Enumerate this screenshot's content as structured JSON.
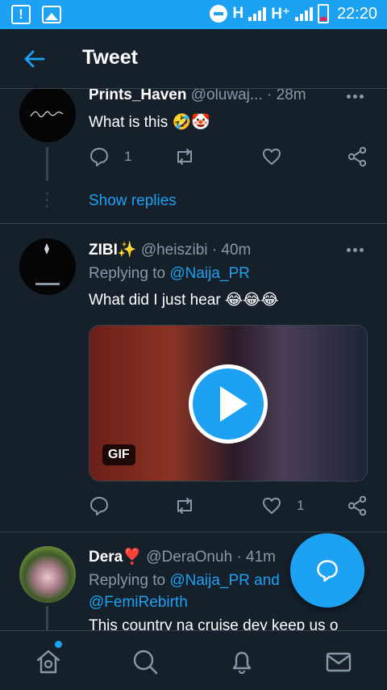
{
  "status_bar": {
    "network_1": "H",
    "network_2": "H⁺",
    "time": "22:20"
  },
  "header": {
    "title": "Tweet",
    "back_icon": "arrow-left-icon"
  },
  "tweets": [
    {
      "name": "Prints_Haven",
      "handle": "@oluwaj...",
      "time": "· 28m",
      "text": "What is this 🤣🤡",
      "reply_count": "1",
      "retweet_count": "",
      "like_count": "",
      "show_replies": "Show replies"
    },
    {
      "name": "ZIBI✨",
      "handle": "@heiszibi",
      "time": "· 40m",
      "replying_label": "Replying to",
      "replying_to": "@Naija_PR",
      "text": "What did I just hear 😂😂😂",
      "media_badge": "GIF",
      "reply_count": "",
      "retweet_count": "",
      "like_count": "1"
    },
    {
      "name": "Dera❣️",
      "handle": "@DeraOnuh",
      "time": "· 41m",
      "replying_label": "Replying to",
      "replying_to": "@Naija_PR",
      "replying_and": "and",
      "replying_to_2": "@FemiRebirth",
      "text": "This country na cruise dey keep us o"
    }
  ],
  "colors": {
    "accent": "#1da1f2",
    "background": "#15202b",
    "divider": "#38444d",
    "muted": "#8899a6"
  }
}
